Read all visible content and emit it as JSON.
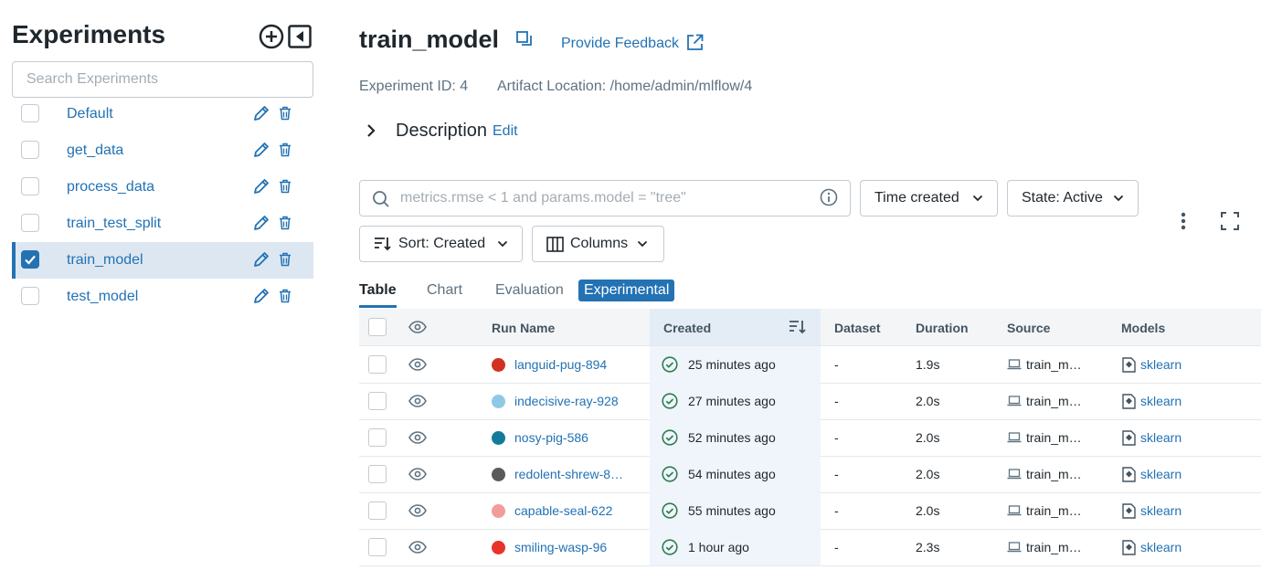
{
  "sidebar": {
    "title": "Experiments",
    "search_placeholder": "Search Experiments",
    "experiments": [
      {
        "name": "Default",
        "selected": false
      },
      {
        "name": "get_data",
        "selected": false
      },
      {
        "name": "process_data",
        "selected": false
      },
      {
        "name": "train_test_split",
        "selected": false
      },
      {
        "name": "train_model",
        "selected": true
      },
      {
        "name": "test_model",
        "selected": false
      }
    ]
  },
  "header": {
    "title": "train_model",
    "feedback_label": "Provide Feedback",
    "experiment_id": "Experiment ID: 4",
    "artifact_location": "Artifact Location: /home/admin/mlflow/4",
    "description_label": "Description",
    "edit_label": "Edit"
  },
  "filters": {
    "search_placeholder": "metrics.rmse < 1 and params.model = \"tree\"",
    "time_created": "Time created",
    "state": "State: Active",
    "sort": "Sort: Created",
    "columns": "Columns"
  },
  "tabs": {
    "table": "Table",
    "chart": "Chart",
    "evaluation": "Evaluation",
    "experimental": "Experimental"
  },
  "table": {
    "headers": {
      "run_name": "Run Name",
      "created": "Created",
      "dataset": "Dataset",
      "duration": "Duration",
      "source": "Source",
      "models": "Models"
    },
    "rows": [
      {
        "run_name": "languid-pug-894",
        "color": "#d1321f",
        "created": "25 minutes ago",
        "dataset": "-",
        "duration": "1.9s",
        "source": "train_m…",
        "model": "sklearn"
      },
      {
        "run_name": "indecisive-ray-928",
        "color": "#8ecae6",
        "created": "27 minutes ago",
        "dataset": "-",
        "duration": "2.0s",
        "source": "train_m…",
        "model": "sklearn"
      },
      {
        "run_name": "nosy-pig-586",
        "color": "#137a9b",
        "created": "52 minutes ago",
        "dataset": "-",
        "duration": "2.0s",
        "source": "train_m…",
        "model": "sklearn"
      },
      {
        "run_name": "redolent-shrew-8…",
        "color": "#5a5a5a",
        "created": "54 minutes ago",
        "dataset": "-",
        "duration": "2.0s",
        "source": "train_m…",
        "model": "sklearn"
      },
      {
        "run_name": "capable-seal-622",
        "color": "#f29c9c",
        "created": "55 minutes ago",
        "dataset": "-",
        "duration": "2.0s",
        "source": "train_m…",
        "model": "sklearn"
      },
      {
        "run_name": "smiling-wasp-96",
        "color": "#e8332a",
        "created": "1 hour ago",
        "dataset": "-",
        "duration": "2.3s",
        "source": "train_m…",
        "model": "sklearn"
      }
    ]
  },
  "colors": {
    "accent": "#2272b4",
    "success": "#2e7d4f"
  }
}
